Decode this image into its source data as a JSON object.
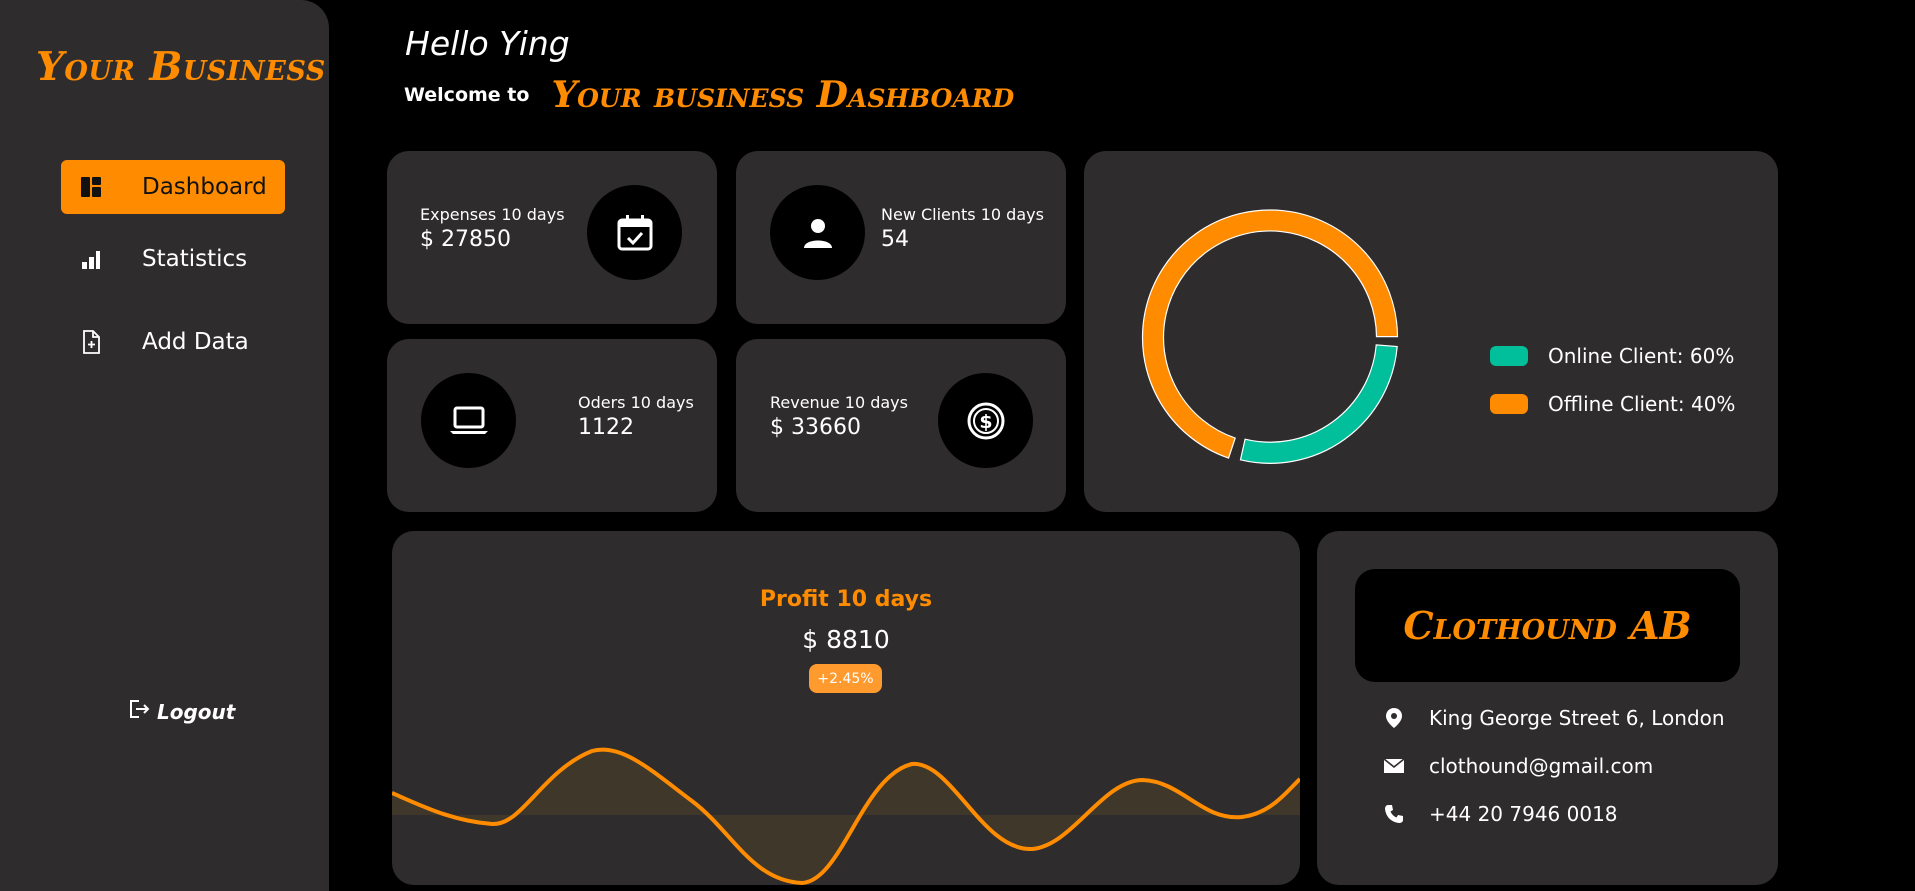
{
  "sidebar": {
    "brand": "Your Business",
    "items": [
      {
        "label": "Dashboard",
        "icon": "dashboard-icon",
        "active": true
      },
      {
        "label": "Statistics",
        "icon": "bar-chart-icon",
        "active": false
      },
      {
        "label": "Add Data",
        "icon": "add-file-icon",
        "active": false
      }
    ],
    "logout_label": "Logout"
  },
  "header": {
    "greeting": "Hello Ying",
    "welcome": "Welcome to",
    "dashboard_title": "Your business Dashboard"
  },
  "stats": {
    "expenses": {
      "label": "Expenses 10 days",
      "value": "$ 27850",
      "icon": "calendar-check-icon"
    },
    "new_clients": {
      "label": "New Clients 10 days",
      "value": "54",
      "icon": "user-icon"
    },
    "orders": {
      "label": "Oders 10 days",
      "value": "1122",
      "icon": "laptop-icon"
    },
    "revenue": {
      "label": "Revenue 10 days",
      "value": "$ 33660",
      "icon": "dollar-coin-icon"
    }
  },
  "clients_donut": {
    "legend": [
      {
        "label": "Online Client: 60%",
        "color": "#00bf9a"
      },
      {
        "label": "Offline Client: 40%",
        "color": "#ff8c00"
      }
    ]
  },
  "profit": {
    "title": "Profit 10 days",
    "value": "$ 8810",
    "change": "+2.45%"
  },
  "company": {
    "name": "Clothound AB",
    "address": "King George Street 6, London",
    "email": "clothound@gmail.com",
    "phone": "+44 20 7946 0018"
  },
  "colors": {
    "accent": "#ff8c00",
    "teal": "#00bf9a",
    "card_bg": "#2e2c2c",
    "page_bg": "#000000"
  }
}
